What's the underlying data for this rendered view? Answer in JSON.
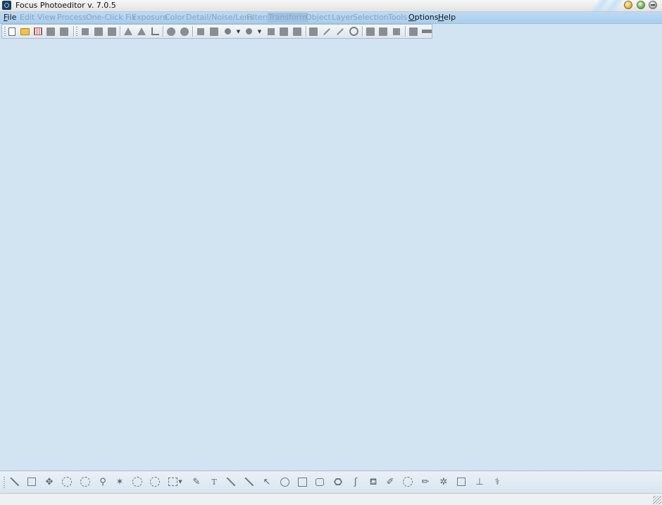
{
  "window": {
    "title": "Focus Photoeditor v. 7.0.5"
  },
  "menu": [
    {
      "label": "File",
      "underline": "F",
      "rest": "ile",
      "enabled": true
    },
    {
      "label": "Edit",
      "enabled": false
    },
    {
      "label": "View",
      "enabled": false
    },
    {
      "label": "Process",
      "enabled": false
    },
    {
      "label": "One-Click Fix",
      "enabled": false
    },
    {
      "label": "Exposure",
      "enabled": false
    },
    {
      "label": "Color",
      "enabled": false
    },
    {
      "label": "Detail/Noise/Lens",
      "enabled": false
    },
    {
      "label": "Filters",
      "enabled": false
    },
    {
      "label": "Transform",
      "enabled": false,
      "highlighted": true
    },
    {
      "label": "Object",
      "enabled": false
    },
    {
      "label": "Layer",
      "enabled": false
    },
    {
      "label": "Selection",
      "enabled": false
    },
    {
      "label": "Tools",
      "enabled": false
    },
    {
      "label": "Options",
      "underline": "O",
      "rest": "ptions",
      "enabled": true
    },
    {
      "label": "Help",
      "underline": "H",
      "rest": "elp",
      "enabled": true
    }
  ],
  "toolbar_icons": [
    "new-document-icon",
    "open-folder-icon",
    "grid-icon",
    "save-icon",
    "save-as-icon",
    "trim-icon",
    "layers-icon",
    "book-icon",
    "flip-horizontal-icon",
    "flip-vertical-icon",
    "crop-icon",
    "rotate-left-icon",
    "rotate-right-icon",
    "brightness-icon",
    "curves-icon",
    "color-circle-icon",
    "color-dropdown-icon",
    "sharpen-icon",
    "sharpen-dropdown-icon",
    "histogram-icon",
    "frame-icon",
    "resize-icon",
    "mask-icon",
    "brush-icon",
    "stars-icon",
    "ring-icon",
    "panel-icon",
    "folder-stack-icon",
    "fullscreen-icon",
    "window-icon",
    "minimize-bar-icon"
  ],
  "bottom_tools": [
    "pointer-tool-icon",
    "rectangle-select-tool-icon",
    "move-tool-icon",
    "hand-tool-icon",
    "zoom-in-tool-icon",
    "zoom-out-tool-icon",
    "magic-wand-tool-icon",
    "lasso-tool-icon",
    "polygon-lasso-tool-icon",
    "marquee-tool-icon",
    "eyedropper-tool-icon",
    "text-tool-icon",
    "line-tool-icon",
    "thin-line-tool-icon",
    "arrow-tool-icon",
    "ellipse-tool-icon",
    "rectangle-tool-icon",
    "rounded-rectangle-tool-icon",
    "hexagon-tool-icon",
    "curve-tool-icon",
    "bucket-tool-icon",
    "brush-tool-icon",
    "airbrush-tool-icon",
    "pencil-tool-icon",
    "spray-tool-icon",
    "eraser-tool-icon",
    "stamp-tool-icon",
    "healing-tool-icon"
  ],
  "bottom_text_tool": "T"
}
